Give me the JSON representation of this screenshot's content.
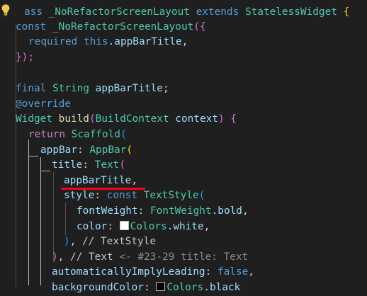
{
  "code": {
    "l1": {
      "kw_class_tail": "ass",
      "class_name": "_NoRefactorScreenLayout",
      "extends_kw": "extends",
      "parent_class": "StatelessWidget",
      "brace": "{"
    },
    "l2": {
      "const_kw": "const",
      "ctor_name": "_NoRefactorScreenLayout",
      "open": "({"
    },
    "l3": {
      "required_kw": "required",
      "this_kw": "this",
      "field": ".appBarTitle",
      "comma": ","
    },
    "l4": {
      "close": "});"
    },
    "l5": {
      "final_kw": "final",
      "type": "String",
      "name": "appBarTitle",
      "semi": ";"
    },
    "l6": {
      "annotation": "@override"
    },
    "l7": {
      "return_type": "Widget",
      "method": "build",
      "open": "(",
      "param_type": "BuildContext",
      "param": "context",
      "close": ")",
      "brace": "{"
    },
    "l8": {
      "return_kw": "return",
      "widget": "Scaffold",
      "open": "("
    },
    "l9": {
      "prop": "appBar",
      "colon": ":",
      "widget": "AppBar",
      "open": "("
    },
    "l10": {
      "prop": "title",
      "colon": ":",
      "widget": "Text",
      "open": "("
    },
    "l11": {
      "var": "appBarTitle",
      "comma": ","
    },
    "l12": {
      "prop": "style",
      "colon": ":",
      "const_kw": "const",
      "widget": "TextStyle",
      "open": "("
    },
    "l13": {
      "prop": "fontWeight",
      "colon": ":",
      "cls": "FontWeight",
      "member": ".bold",
      "comma": ","
    },
    "l14": {
      "prop": "color",
      "colon": ":",
      "cls": "Colors",
      "member": ".white",
      "comma": ","
    },
    "l15": {
      "close": ")",
      "comma": ",",
      "comment": "// TextStyle"
    },
    "l16": {
      "close": ")",
      "comma": ",",
      "comment": "// Text",
      "hint": "<- #23-29 title: Text"
    },
    "l17": {
      "prop": "automaticallyImplyLeading",
      "colon": ":",
      "value": "false",
      "comma": ","
    },
    "l18": {
      "prop": "backgroundColor",
      "colon": ":",
      "cls": "Colors",
      "member": ".black"
    }
  },
  "colors": {
    "background": "#1f1f1f",
    "keyword": "#569cd6",
    "control": "#c586c0",
    "type": "#4ec9b0",
    "function": "#dcdcaa",
    "variable": "#9cdcfe",
    "bracket_1": "#ffd700",
    "bracket_2": "#da70d6",
    "bracket_3": "#179fff",
    "underline": "#ff0019",
    "white_swatch": "#ffffff"
  },
  "icons": {
    "lightbulb": "lightbulb-icon",
    "color_swatch": "color-swatch-icon"
  }
}
